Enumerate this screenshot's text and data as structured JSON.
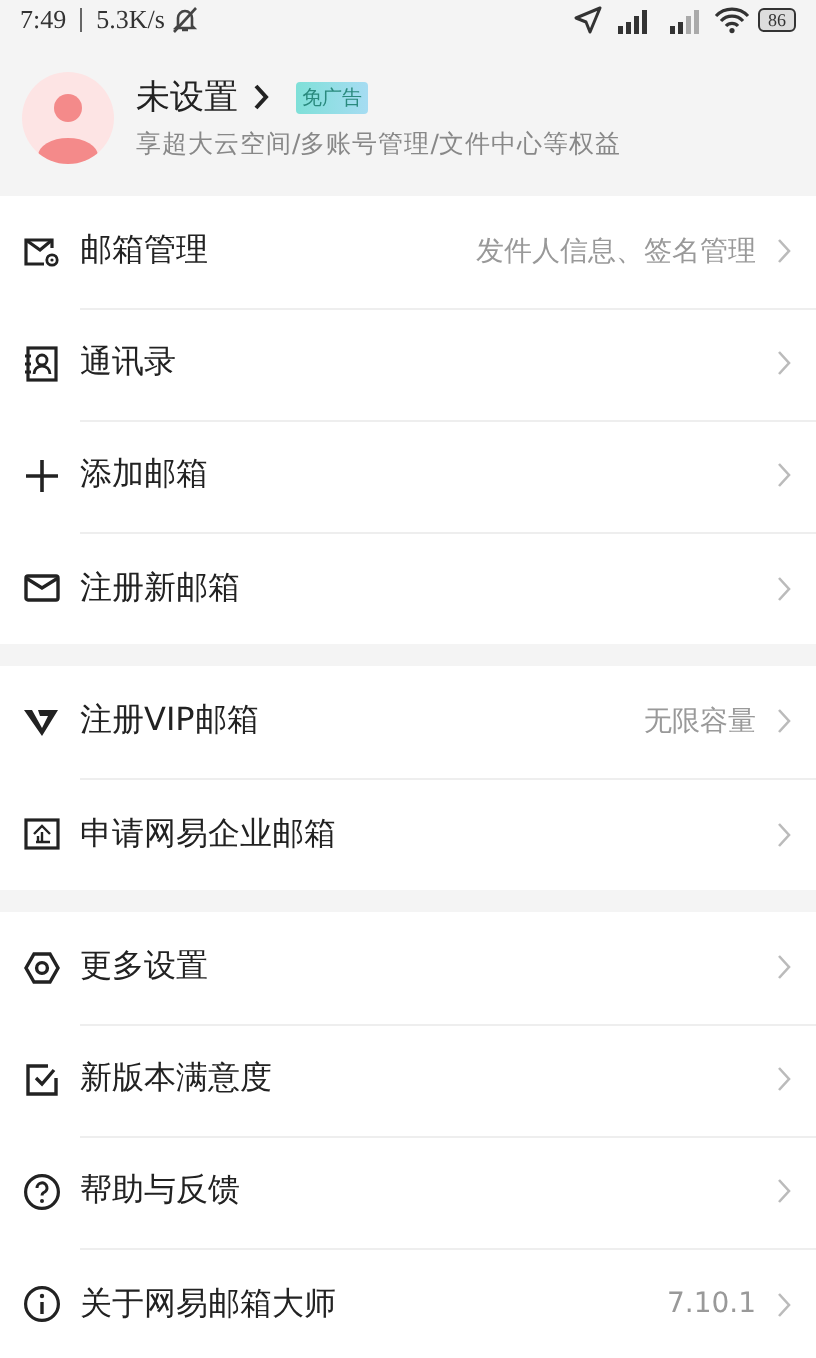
{
  "status_bar": {
    "time": "7:49",
    "speed": "5.3K/s",
    "battery": "86"
  },
  "profile": {
    "name": "未设置",
    "badge": "免广告",
    "subtitle": "享超大云空间/多账号管理/文件中心等权益"
  },
  "groups": [
    [
      {
        "kind": "mail-gear",
        "label": "邮箱管理",
        "detail": "发件人信息、签名管理"
      },
      {
        "kind": "contacts",
        "label": "通讯录"
      },
      {
        "kind": "plus",
        "label": "添加邮箱"
      },
      {
        "kind": "mail",
        "label": "注册新邮箱"
      }
    ],
    [
      {
        "kind": "vip",
        "label": "注册VIP邮箱",
        "detail": "无限容量"
      },
      {
        "kind": "enterprise",
        "label": "申请网易企业邮箱"
      }
    ],
    [
      {
        "kind": "settings",
        "label": "更多设置"
      },
      {
        "kind": "checkbox",
        "label": "新版本满意度"
      },
      {
        "kind": "help",
        "label": "帮助与反馈"
      },
      {
        "kind": "info",
        "label": "关于网易邮箱大师",
        "detail": "7.10.1"
      }
    ]
  ]
}
